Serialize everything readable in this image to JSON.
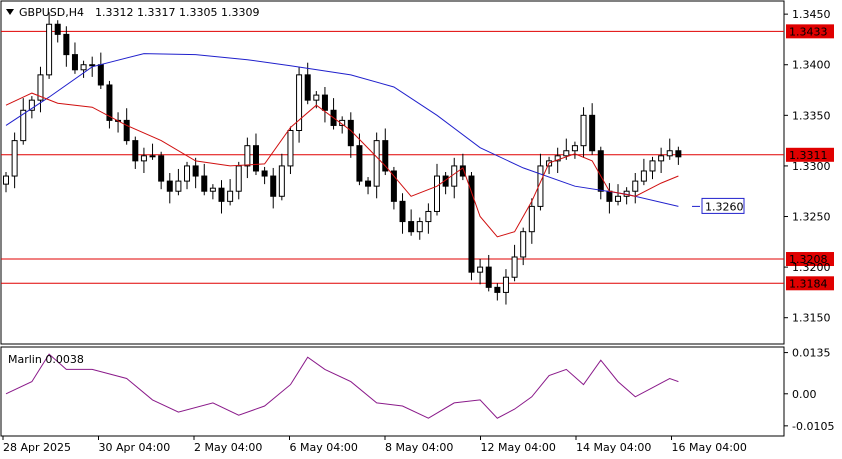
{
  "header": {
    "symbol": "GBPUSD,H4",
    "ohlc": "1.3312 1.3317 1.3305 1.3309"
  },
  "indicator": {
    "label": "Marlin 0.0038"
  },
  "colors": {
    "up": "#ffffff",
    "down": "#000000",
    "ma_slow": "#2020cc",
    "ma_fast": "#d01010",
    "levels": "#e00000",
    "oscillator": "#8a1a8a",
    "grid": "#d8d8d8"
  },
  "chart_data": {
    "type": "candlestick",
    "title": "GBPUSD,H4",
    "timeframe": "H4",
    "price_ylim": [
      1.3125,
      1.3462
    ],
    "price_ticks": [
      "1.3450",
      "1.3400",
      "1.3350",
      "1.3300",
      "1.3250",
      "1.3200",
      "1.3150"
    ],
    "x_labels": [
      "28 Apr 2025",
      "30 Apr 04:00",
      "2 May 04:00",
      "6 May 04:00",
      "8 May 04:00",
      "12 May 04:00",
      "14 May 04:00",
      "16 May 04:00"
    ],
    "levels": [
      {
        "label": "1.3433",
        "value": 1.3433
      },
      {
        "label": "1.3311",
        "value": 1.3311
      },
      {
        "label": "1.3208",
        "value": 1.3208
      },
      {
        "label": "1.3184",
        "value": 1.3184
      }
    ],
    "ma_label": {
      "label": "1.3260",
      "value": 1.326
    },
    "closes": [
      1.329,
      1.3325,
      1.3355,
      1.3365,
      1.339,
      1.344,
      1.343,
      1.341,
      1.3395,
      1.34,
      1.34,
      1.338,
      1.3345,
      1.3345,
      1.3325,
      1.3305,
      1.331,
      1.331,
      1.3285,
      1.3275,
      1.3285,
      1.33,
      1.329,
      1.3275,
      1.3278,
      1.3265,
      1.3275,
      1.33,
      1.332,
      1.3295,
      1.329,
      1.327,
      1.33,
      1.3335,
      1.339,
      1.3365,
      1.337,
      1.3355,
      1.334,
      1.3345,
      1.332,
      1.3285,
      1.328,
      1.3325,
      1.3295,
      1.3265,
      1.3245,
      1.3235,
      1.3245,
      1.3255,
      1.329,
      1.328,
      1.33,
      1.329,
      1.3195,
      1.32,
      1.318,
      1.3175,
      1.319,
      1.321,
      1.3235,
      1.326,
      1.33,
      1.3305,
      1.331,
      1.3315,
      1.332,
      1.335,
      1.3315,
      1.3275,
      1.3265,
      1.327,
      1.3275,
      1.3285,
      1.3295,
      1.3305,
      1.331,
      1.3315,
      1.3309
    ],
    "ma_slow": [
      [
        0,
        1.334
      ],
      [
        5,
        1.3368
      ],
      [
        10,
        1.3398
      ],
      [
        16,
        1.3411
      ],
      [
        22,
        1.341
      ],
      [
        28,
        1.3405
      ],
      [
        33,
        1.3399
      ],
      [
        40,
        1.339
      ],
      [
        45,
        1.3378
      ],
      [
        50,
        1.335
      ],
      [
        55,
        1.3318
      ],
      [
        60,
        1.3298
      ],
      [
        66,
        1.328
      ],
      [
        72,
        1.3272
      ],
      [
        78,
        1.326
      ]
    ],
    "ma_fast": [
      [
        0,
        1.336
      ],
      [
        3,
        1.3372
      ],
      [
        6,
        1.3362
      ],
      [
        10,
        1.3358
      ],
      [
        14,
        1.334
      ],
      [
        18,
        1.3325
      ],
      [
        22,
        1.3305
      ],
      [
        26,
        1.33
      ],
      [
        30,
        1.3302
      ],
      [
        33,
        1.3338
      ],
      [
        36,
        1.336
      ],
      [
        40,
        1.3335
      ],
      [
        44,
        1.33
      ],
      [
        47,
        1.327
      ],
      [
        50,
        1.328
      ],
      [
        53,
        1.3298
      ],
      [
        55,
        1.325
      ],
      [
        57,
        1.323
      ],
      [
        59,
        1.3235
      ],
      [
        61,
        1.3265
      ],
      [
        63,
        1.3303
      ],
      [
        66,
        1.3312
      ],
      [
        68,
        1.3305
      ],
      [
        70,
        1.3275
      ],
      [
        73,
        1.327
      ],
      [
        76,
        1.3283
      ],
      [
        78,
        1.329
      ]
    ],
    "oscillator_ylim": [
      -0.0135,
      0.015
    ],
    "oscillator_ticks": [
      "0.0135",
      "0.00",
      "-0.0105"
    ],
    "oscillator": [
      [
        0,
        0.0
      ],
      [
        3,
        0.004
      ],
      [
        5,
        0.013
      ],
      [
        7,
        0.008
      ],
      [
        10,
        0.008
      ],
      [
        14,
        0.005
      ],
      [
        17,
        -0.002
      ],
      [
        20,
        -0.006
      ],
      [
        24,
        -0.003
      ],
      [
        27,
        -0.007
      ],
      [
        30,
        -0.004
      ],
      [
        33,
        0.003
      ],
      [
        35,
        0.012
      ],
      [
        37,
        0.008
      ],
      [
        40,
        0.004
      ],
      [
        43,
        -0.003
      ],
      [
        46,
        -0.004
      ],
      [
        49,
        -0.008
      ],
      [
        52,
        -0.003
      ],
      [
        55,
        -0.002
      ],
      [
        57,
        -0.008
      ],
      [
        59,
        -0.005
      ],
      [
        61,
        -0.001
      ],
      [
        63,
        0.006
      ],
      [
        65,
        0.008
      ],
      [
        67,
        0.003
      ],
      [
        69,
        0.011
      ],
      [
        71,
        0.004
      ],
      [
        73,
        -0.001
      ],
      [
        75,
        0.002
      ],
      [
        77,
        0.005
      ],
      [
        78,
        0.004
      ]
    ]
  }
}
